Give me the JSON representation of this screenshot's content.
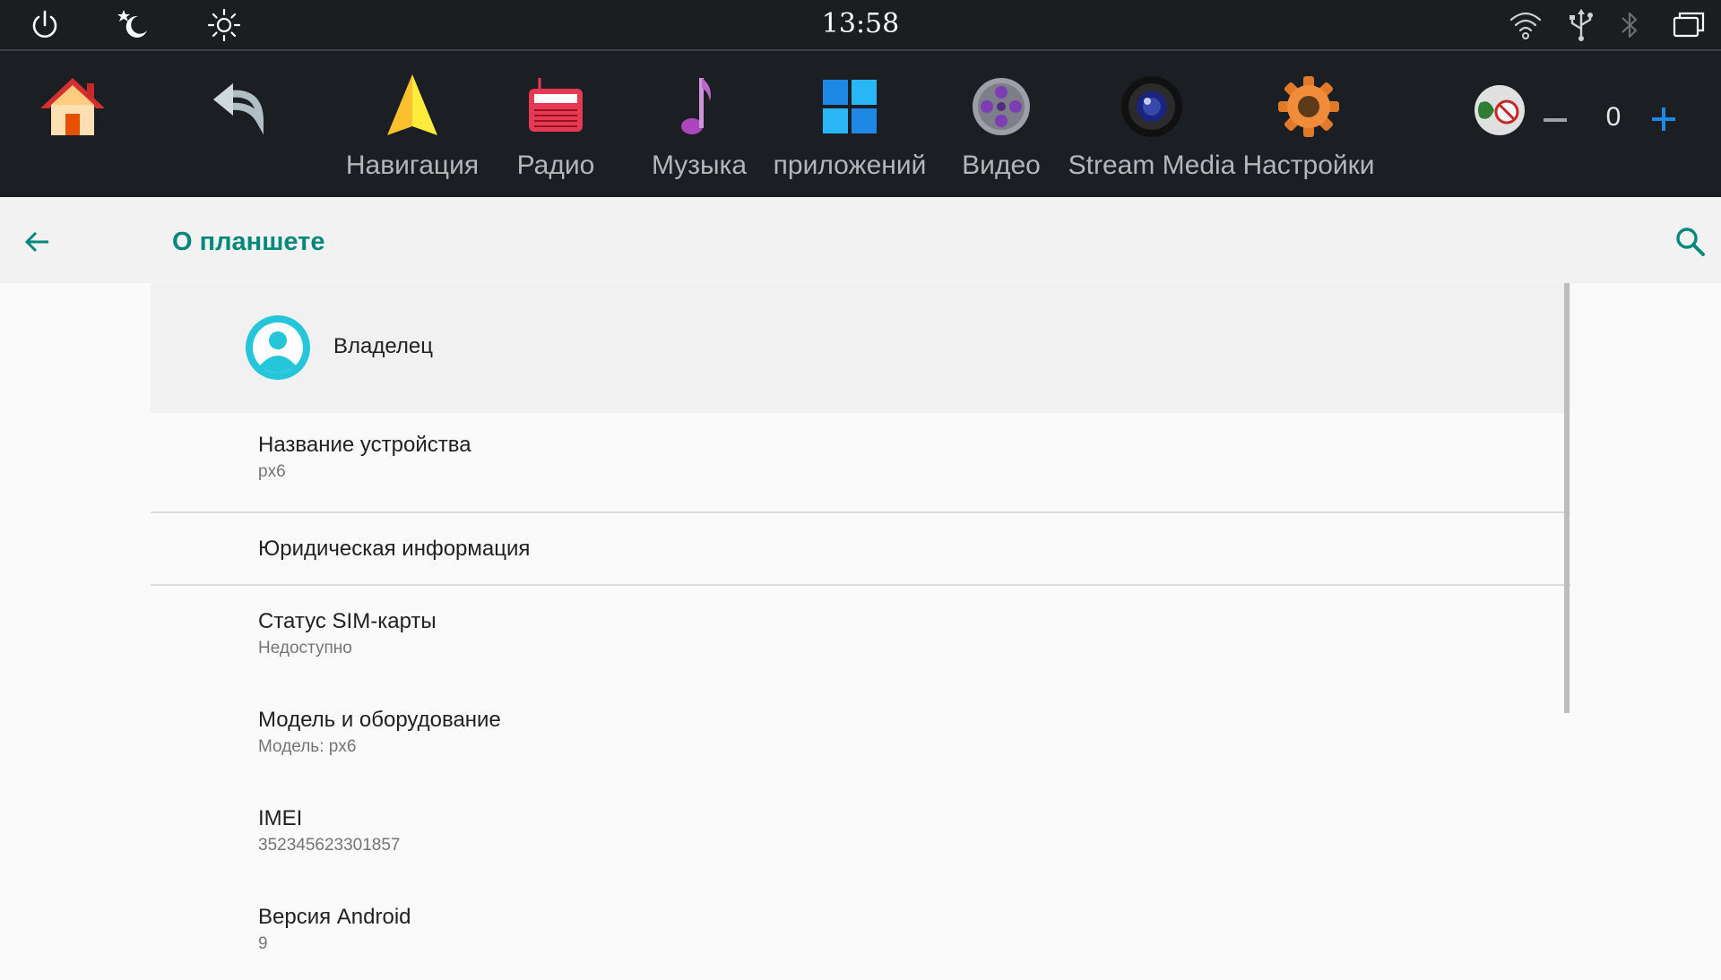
{
  "status_bar": {
    "time": "13:58",
    "left_icons": [
      "power-icon",
      "night-mode-icon",
      "brightness-icon"
    ],
    "right_icons": [
      "wifi-icon",
      "usb-icon",
      "bluetooth-icon",
      "recent-apps-icon"
    ]
  },
  "launcher": {
    "apps": [
      {
        "name": "home",
        "label": "",
        "icon": "home-icon"
      },
      {
        "name": "back",
        "label": "",
        "icon": "back-arrow-icon"
      },
      {
        "name": "navigation",
        "label": "Навигация",
        "icon": "navigation-icon"
      },
      {
        "name": "radio",
        "label": "Радио",
        "icon": "radio-icon"
      },
      {
        "name": "music",
        "label": "Музыка",
        "icon": "music-note-icon"
      },
      {
        "name": "apps",
        "label": "приложений",
        "icon": "apps-grid-icon"
      },
      {
        "name": "video",
        "label": "Видео",
        "icon": "film-reel-icon"
      },
      {
        "name": "stream-media",
        "label": "Stream Media",
        "icon": "camera-lens-icon"
      },
      {
        "name": "settings",
        "label": "Настройки",
        "icon": "gear-icon"
      }
    ],
    "volume": {
      "value": "0",
      "icon": "speaker-muted-icon"
    }
  },
  "header": {
    "title": "О планшете",
    "back_icon": "back-arrow-icon",
    "search_icon": "search-icon"
  },
  "owner": {
    "label": "Владелец",
    "icon": "account-circle-icon"
  },
  "settings_items": [
    {
      "title": "Название устройства",
      "subtitle": "px6"
    },
    {
      "title": "Юридическая информация",
      "subtitle": ""
    },
    {
      "title": "Статус SIM-карты",
      "subtitle": "Недоступно"
    },
    {
      "title": "Модель и оборудование",
      "subtitle": "Модель: px6"
    },
    {
      "title": "IMEI",
      "subtitle": "352345623301857"
    },
    {
      "title": "Версия Android",
      "subtitle": "9"
    }
  ],
  "colors": {
    "accent": "#00897b",
    "status_bar_bg": "#1b1e21",
    "avatar": "#26c6da",
    "volume_plus": "#1e88e5"
  }
}
